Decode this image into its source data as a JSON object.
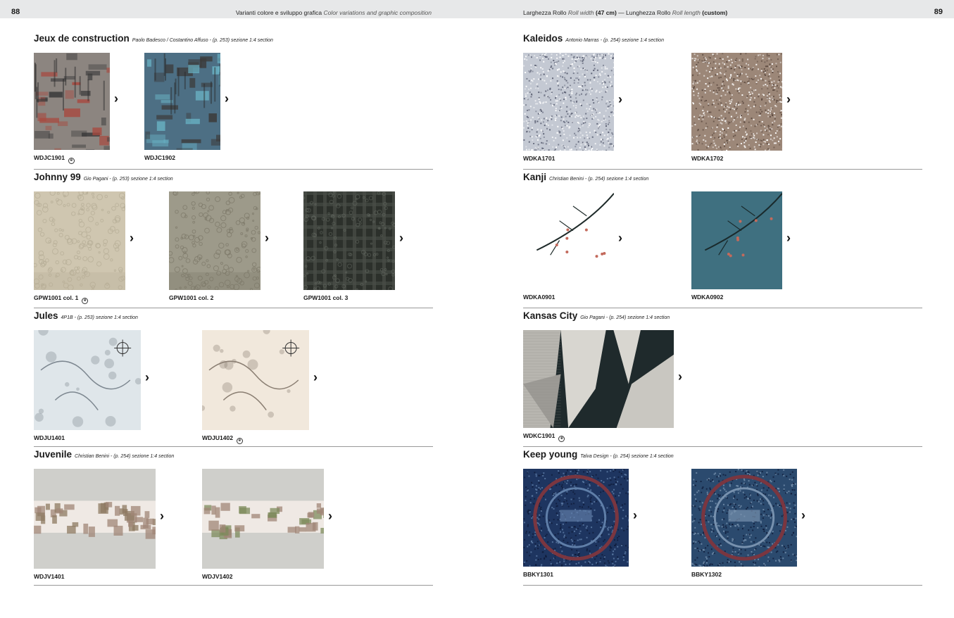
{
  "header": {
    "left_page_number": "88",
    "right_page_number": "89",
    "left_title": "Varianti colore e sviluppo grafica",
    "left_title_en": "Color variations and graphic composition",
    "right_w_label": "Larghezza Rollo",
    "right_w_en": "Roll width",
    "right_w_value": "(47 cm)",
    "right_dash": " — ",
    "right_l_label": "Lunghezza Rollo",
    "right_l_en": "Roll length",
    "right_l_value": "(custom)"
  },
  "arrow_glyph": "›",
  "eco_glyph": "e",
  "left": [
    {
      "title": "Jeux de construction",
      "subtitle": "Paolo Badesco / Costantino Affuso - (p. 253) sezione 1:4 section",
      "swatches": [
        {
          "code": "WDJC1901",
          "eco": true,
          "kind": "blocks",
          "c1": "#8c8580",
          "c2": "#a8493f"
        },
        {
          "code": "WDJC1902",
          "eco": false,
          "kind": "blocks",
          "c1": "#4d6f84",
          "c2": "#6ab4c6"
        }
      ]
    },
    {
      "title": "Johnny 99",
      "subtitle": "Gio Pagani  - (p. 253) sezione 1:4 section",
      "swatches": [
        {
          "code": "GPW1001 col. 1",
          "eco": true,
          "kind": "lace",
          "c1": "#cfc6b0",
          "c2": "#b5ad96"
        },
        {
          "code": "GPW1001 col. 2",
          "eco": false,
          "kind": "lace",
          "c1": "#9d9a8a",
          "c2": "#7c7868"
        },
        {
          "code": "GPW1001 col. 3",
          "eco": false,
          "kind": "plaid",
          "c1": "#2c302b",
          "c2": "#4a4f48"
        }
      ]
    },
    {
      "title": "Jules",
      "subtitle": "4P1B  - (p. 253) sezione 1:4 section",
      "swatches": [
        {
          "code": "WDJU1401",
          "eco": false,
          "kind": "map",
          "c1": "#dfe6ea",
          "c2": "#7d8790"
        },
        {
          "code": "WDJU1402",
          "eco": true,
          "kind": "map",
          "c1": "#f1e8dc",
          "c2": "#8a7e72"
        }
      ]
    },
    {
      "title": "Juvenile",
      "subtitle": "Christian Benini  - (p. 254) sezione 1:4 section",
      "swatches": [
        {
          "code": "WDJV1401",
          "eco": false,
          "kind": "band",
          "c1": "#cfcfcb",
          "c2": "#8e7a62"
        },
        {
          "code": "WDJV1402",
          "eco": false,
          "kind": "band",
          "c1": "#cfcfcb",
          "c2": "#7e8b5c"
        }
      ]
    }
  ],
  "right": [
    {
      "title": "Kaleidos",
      "subtitle": "Antonio Marras  - (p. 254) sezione 1:4 section",
      "swatches": [
        {
          "code": "WDKA1701",
          "eco": false,
          "kind": "noise",
          "c1": "#c4c9d3",
          "c2": "#5b6073"
        },
        {
          "code": "WDKA1702",
          "eco": false,
          "kind": "noise",
          "c1": "#9c8778",
          "c2": "#5e4c42"
        }
      ]
    },
    {
      "title": "Kanji",
      "subtitle": "Christian Benini  - (p. 254) sezione 1:4 section",
      "swatches": [
        {
          "code": "WDKA0901",
          "eco": false,
          "kind": "branch",
          "c1": "#ffffff",
          "c2": "#1f2b2a"
        },
        {
          "code": "WDKA0902",
          "eco": false,
          "kind": "branch",
          "c1": "#3f7080",
          "c2": "#1a2a2c"
        }
      ]
    },
    {
      "title": "Kansas City",
      "subtitle": "Gio Pagani - (p. 254) sezione 1:4 section",
      "swatches": [
        {
          "code": "WDKC1901",
          "eco": true,
          "kind": "geo",
          "c1": "#1f2a2c",
          "c2": "#d8d6d0"
        }
      ]
    },
    {
      "title": "Keep young",
      "subtitle": "Talva Design  - (p. 254) sezione 1:4 section",
      "swatches": [
        {
          "code": "BBKY1301",
          "eco": false,
          "kind": "mosaic",
          "c1": "#1e3560",
          "c2": "#5f7ea8"
        },
        {
          "code": "BBKY1302",
          "eco": false,
          "kind": "mosaic",
          "c1": "#2b4a6e",
          "c2": "#7791ae"
        }
      ]
    }
  ]
}
